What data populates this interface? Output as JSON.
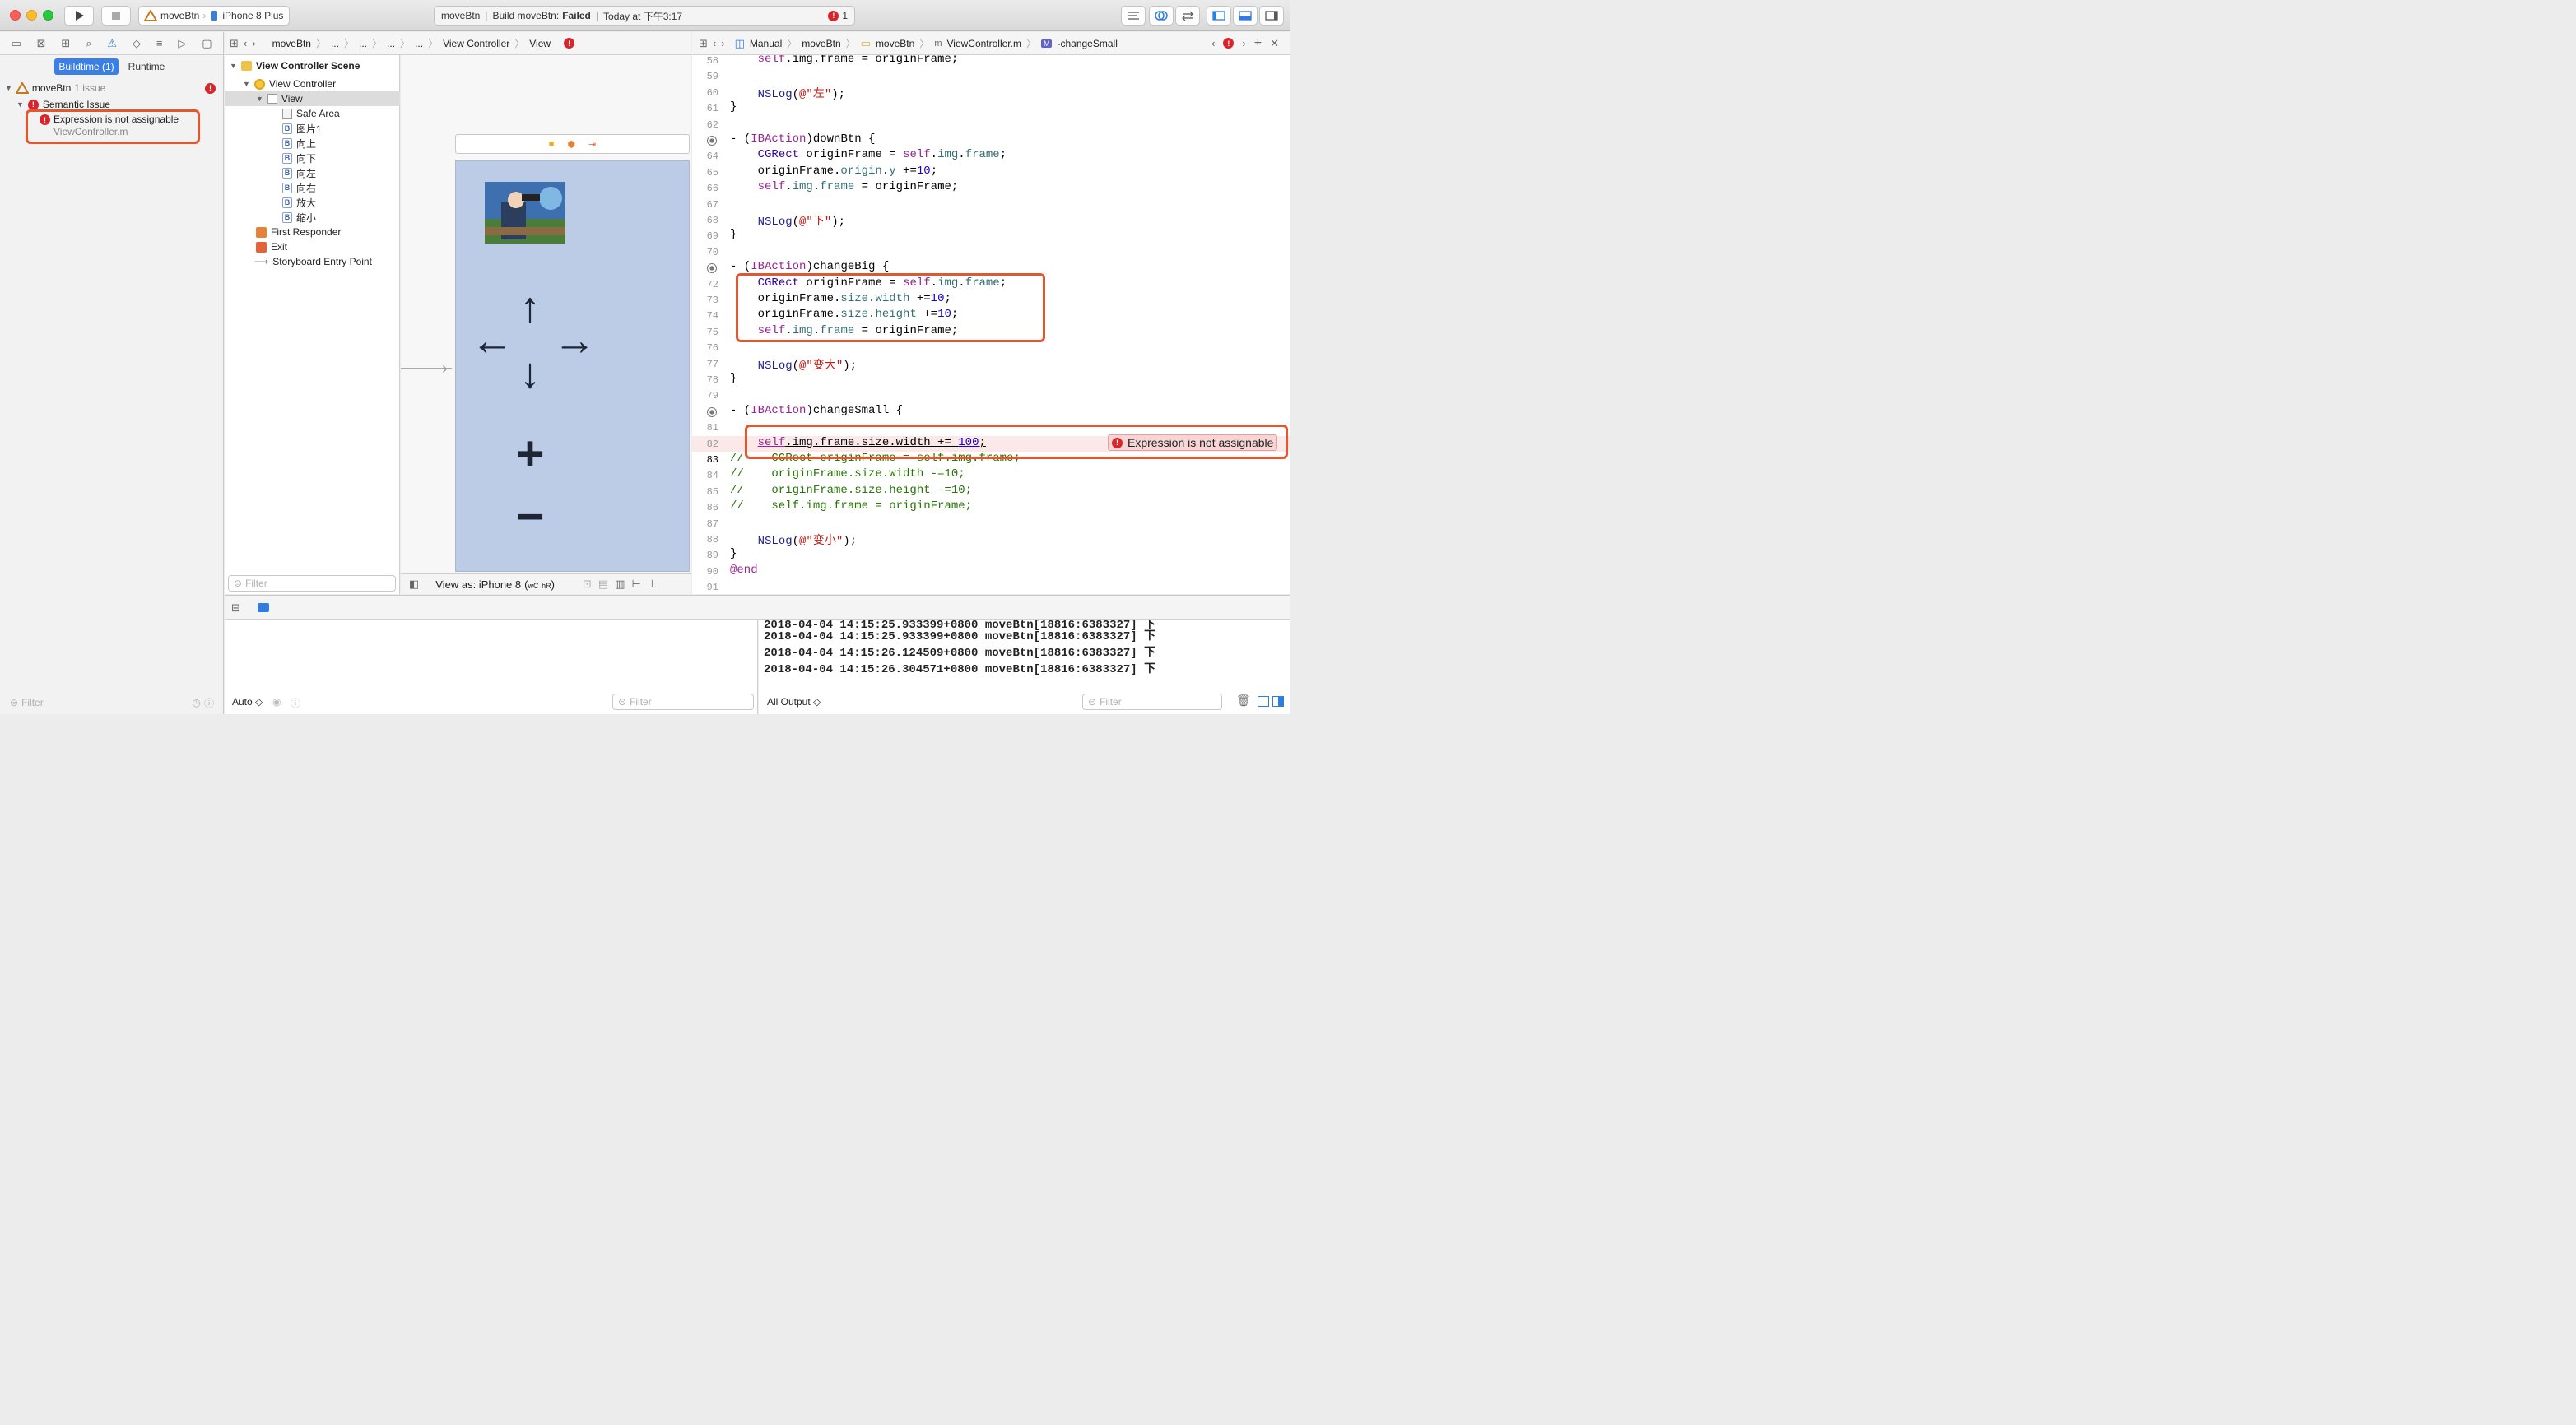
{
  "toolbar": {
    "scheme_target": "moveBtn",
    "scheme_device": "iPhone 8 Plus",
    "activity_project": "moveBtn",
    "activity_status": "Build moveBtn:",
    "activity_result": "Failed",
    "activity_time": "Today at 下午3:17",
    "issue_count": "1"
  },
  "navigator": {
    "tabs": [
      "Buildtime (1)",
      "Runtime"
    ],
    "project": "moveBtn",
    "project_issues": "1 issue",
    "category": "Semantic Issue",
    "issue_message": "Expression is not assignable",
    "issue_file": "ViewController.m",
    "filter_placeholder": "Filter"
  },
  "ib_jumpbar": [
    "moveBtn",
    "...",
    "...",
    "...",
    "...",
    "View Controller",
    "View"
  ],
  "outline": {
    "scene": "View Controller Scene",
    "controller": "View Controller",
    "view": "View",
    "children": [
      "Safe Area",
      "图片1",
      "向上",
      "向下",
      "向左",
      "向右",
      "放大",
      "缩小"
    ],
    "others": [
      "First Responder",
      "Exit",
      "Storyboard Entry Point"
    ],
    "filter_placeholder": "Filter"
  },
  "canvas": {
    "view_as": "View as: iPhone 8",
    "size_class_w": "wC",
    "size_class_h": "hR",
    "glyph_up": "↑",
    "glyph_down": "↓",
    "glyph_left": "←",
    "glyph_right": "→",
    "glyph_plus": "+",
    "glyph_minus": "−",
    "scene_bar_glyphs": [
      "■",
      "⬢",
      "⇥"
    ]
  },
  "editor_jumpbar": [
    "Manual",
    "moveBtn",
    "moveBtn",
    "ViewController.m",
    "-changeSmall"
  ],
  "code": {
    "error_message": "Expression is not assignable",
    "current_line": "83",
    "lines": [
      {
        "n": "58",
        "segs": [
          [
            "",
            "    "
          ],
          [
            "kw",
            "self"
          ],
          [
            "",
            ".img.frame = originFrame;"
          ]
        ]
      },
      {
        "n": "59",
        "segs": []
      },
      {
        "n": "60",
        "segs": [
          [
            "",
            "    "
          ],
          [
            "fn",
            "NSLog"
          ],
          [
            "",
            "("
          ],
          [
            "st",
            "@\"左\""
          ],
          [
            "",
            ");"
          ]
        ]
      },
      {
        "n": "61",
        "segs": [
          [
            "",
            "}"
          ]
        ]
      },
      {
        "n": "62",
        "segs": []
      },
      {
        "n": "63",
        "segs": [
          [
            "",
            "- ("
          ],
          [
            "kw",
            "IBAction"
          ],
          [
            "",
            ")downBtn {"
          ]
        ]
      },
      {
        "n": "64",
        "segs": [
          [
            "",
            "    "
          ],
          [
            "ty",
            "CGRect"
          ],
          [
            "",
            " originFrame = "
          ],
          [
            "kw",
            "self"
          ],
          [
            "",
            "."
          ],
          [
            "pr",
            "img"
          ],
          [
            "",
            "."
          ],
          [
            "pr",
            "frame"
          ],
          [
            "",
            ";"
          ]
        ]
      },
      {
        "n": "65",
        "segs": [
          [
            "",
            "    originFrame."
          ],
          [
            "pr",
            "origin"
          ],
          [
            "",
            "."
          ],
          [
            "pr",
            "y"
          ],
          [
            "",
            " +="
          ],
          [
            "nu",
            "10"
          ],
          [
            "",
            ";"
          ]
        ]
      },
      {
        "n": "66",
        "segs": [
          [
            "",
            "    "
          ],
          [
            "kw",
            "self"
          ],
          [
            "",
            "."
          ],
          [
            "pr",
            "img"
          ],
          [
            "",
            "."
          ],
          [
            "pr",
            "frame"
          ],
          [
            "",
            " = originFrame;"
          ]
        ]
      },
      {
        "n": "67",
        "segs": []
      },
      {
        "n": "68",
        "segs": [
          [
            "",
            "    "
          ],
          [
            "fn",
            "NSLog"
          ],
          [
            "",
            "("
          ],
          [
            "st",
            "@\"下\""
          ],
          [
            "",
            ");"
          ]
        ]
      },
      {
        "n": "69",
        "segs": [
          [
            "",
            "}"
          ]
        ]
      },
      {
        "n": "70",
        "segs": []
      },
      {
        "n": "71",
        "segs": [
          [
            "",
            "- ("
          ],
          [
            "kw",
            "IBAction"
          ],
          [
            "",
            ")changeBig {"
          ]
        ]
      },
      {
        "n": "72",
        "segs": [
          [
            "",
            "    "
          ],
          [
            "ty",
            "CGRect"
          ],
          [
            "",
            " originFrame = "
          ],
          [
            "kw",
            "self"
          ],
          [
            "",
            "."
          ],
          [
            "pr",
            "img"
          ],
          [
            "",
            "."
          ],
          [
            "pr",
            "frame"
          ],
          [
            "",
            ";"
          ]
        ]
      },
      {
        "n": "73",
        "segs": [
          [
            "",
            "    originFrame."
          ],
          [
            "pr",
            "size"
          ],
          [
            "",
            "."
          ],
          [
            "pr",
            "width"
          ],
          [
            "",
            " +="
          ],
          [
            "nu",
            "10"
          ],
          [
            "",
            ";"
          ]
        ]
      },
      {
        "n": "74",
        "segs": [
          [
            "",
            "    originFrame."
          ],
          [
            "pr",
            "size"
          ],
          [
            "",
            "."
          ],
          [
            "pr",
            "height"
          ],
          [
            "",
            " +="
          ],
          [
            "nu",
            "10"
          ],
          [
            "",
            ";"
          ]
        ]
      },
      {
        "n": "75",
        "segs": [
          [
            "",
            "    "
          ],
          [
            "kw",
            "self"
          ],
          [
            "",
            "."
          ],
          [
            "pr",
            "img"
          ],
          [
            "",
            "."
          ],
          [
            "pr",
            "frame"
          ],
          [
            "",
            " = originFrame;"
          ]
        ]
      },
      {
        "n": "76",
        "segs": []
      },
      {
        "n": "77",
        "segs": [
          [
            "",
            "    "
          ],
          [
            "fn",
            "NSLog"
          ],
          [
            "",
            "("
          ],
          [
            "st",
            "@\"变大\""
          ],
          [
            "",
            ");"
          ]
        ]
      },
      {
        "n": "78",
        "segs": [
          [
            "",
            "}"
          ]
        ]
      },
      {
        "n": "79",
        "segs": []
      },
      {
        "n": "80",
        "segs": [
          [
            "",
            "- ("
          ],
          [
            "kw",
            "IBAction"
          ],
          [
            "",
            ")changeSmall {"
          ]
        ]
      },
      {
        "n": "81",
        "segs": []
      },
      {
        "n": "82",
        "segs": [
          [
            "",
            "    "
          ],
          [
            "kw",
            "self"
          ],
          [
            "",
            ".img.frame.size.width += "
          ],
          [
            "nu",
            "100"
          ],
          [
            "",
            ";"
          ]
        ]
      },
      {
        "n": "83",
        "segs": [
          [
            "cm",
            "//    CGRect originFrame = self.img.frame;"
          ]
        ]
      },
      {
        "n": "84",
        "segs": [
          [
            "cm",
            "//    originFrame.size.width -=10;"
          ]
        ]
      },
      {
        "n": "85",
        "segs": [
          [
            "cm",
            "//    originFrame.size.height -=10;"
          ]
        ]
      },
      {
        "n": "86",
        "segs": [
          [
            "cm",
            "//    self.img.frame = originFrame;"
          ]
        ]
      },
      {
        "n": "87",
        "segs": []
      },
      {
        "n": "88",
        "segs": [
          [
            "",
            "    "
          ],
          [
            "fn",
            "NSLog"
          ],
          [
            "",
            "("
          ],
          [
            "st",
            "@\"变小\""
          ],
          [
            "",
            ");"
          ]
        ]
      },
      {
        "n": "89",
        "segs": [
          [
            "",
            "}"
          ]
        ]
      },
      {
        "n": "90",
        "segs": [
          [
            "kw",
            "@end"
          ]
        ]
      },
      {
        "n": "91",
        "segs": []
      }
    ]
  },
  "console": {
    "lines": [
      "2018-04-04 14:15:25.933399+0800 moveBtn[18816:6383327] 下",
      "2018-04-04 14:15:26.124509+0800 moveBtn[18816:6383327] 下",
      "2018-04-04 14:15:26.304571+0800 moveBtn[18816:6383327] 下"
    ],
    "output_selector": "All Output ◇",
    "filter_placeholder": "Filter"
  },
  "variables": {
    "mode": "Auto ◇",
    "filter_placeholder": "Filter"
  },
  "colors": {
    "error_red": "#d6262b",
    "annotation_orange": "#e4572e",
    "selection_blue": "#3b7fe5",
    "canvas_view": "#bccbe6"
  }
}
